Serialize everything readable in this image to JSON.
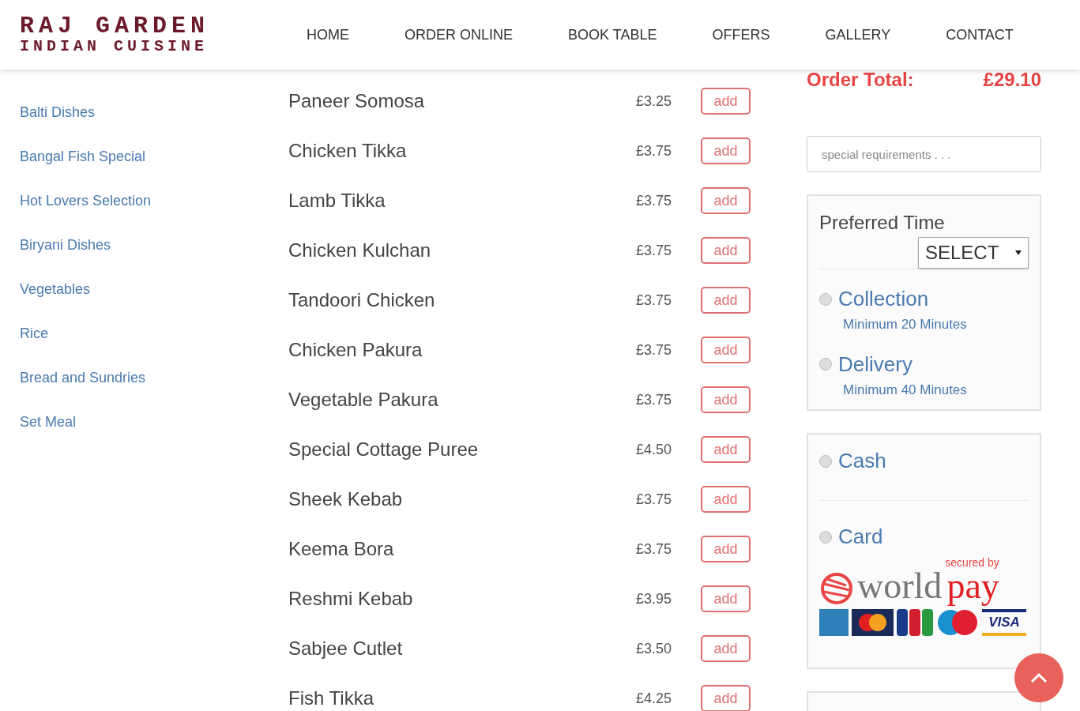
{
  "header": {
    "logo_title": "RAJ GARDEN",
    "logo_subtitle": "INDIAN CUISINE",
    "nav": [
      {
        "label": "HOME"
      },
      {
        "label": "ORDER ONLINE"
      },
      {
        "label": "BOOK TABLE"
      },
      {
        "label": "OFFERS"
      },
      {
        "label": "GALLERY"
      },
      {
        "label": "CONTACT"
      }
    ]
  },
  "categories": [
    "Balti Dishes",
    "Bangal Fish Special",
    "Hot Lovers Selection",
    "Biryani Dishes",
    "Vegetables",
    "Rice",
    "Bread and Sundries",
    "Set Meal"
  ],
  "menu_items": [
    {
      "name": "Paneer Somosa",
      "price": "£3.25",
      "button": "add"
    },
    {
      "name": "Chicken Tikka",
      "price": "£3.75",
      "button": "add"
    },
    {
      "name": "Lamb Tikka",
      "price": "£3.75",
      "button": "add"
    },
    {
      "name": "Chicken Kulchan",
      "price": "£3.75",
      "button": "add"
    },
    {
      "name": "Tandoori Chicken",
      "price": "£3.75",
      "button": "add"
    },
    {
      "name": "Chicken Pakura",
      "price": "£3.75",
      "button": "add"
    },
    {
      "name": "Vegetable Pakura",
      "price": "£3.75",
      "button": "add"
    },
    {
      "name": "Special Cottage Puree",
      "price": "£4.50",
      "button": "add"
    },
    {
      "name": "Sheek Kebab",
      "price": "£3.75",
      "button": "add"
    },
    {
      "name": "Keema Bora",
      "price": "£3.75",
      "button": "add"
    },
    {
      "name": "Reshmi Kebab",
      "price": "£3.95",
      "button": "add"
    },
    {
      "name": "Sabjee Cutlet",
      "price": "£3.50",
      "button": "add"
    },
    {
      "name": "Fish Tikka",
      "price": "£4.25",
      "button": "add"
    }
  ],
  "order": {
    "total_label": "Order Total:",
    "total_value": "£29.10",
    "requirements": {
      "placeholder": "special requirements . . ."
    },
    "preferred_time": {
      "label": "Preferred Time",
      "select": "SELECT"
    },
    "fulfilment": [
      {
        "label": "Collection",
        "note": "Minimum 20 Minutes",
        "selected": false
      },
      {
        "label": "Delivery",
        "note": "Minimum 40 Minutes",
        "selected": false
      }
    ],
    "payment": [
      {
        "label": "Cash",
        "selected": false
      },
      {
        "label": "Card",
        "selected": false
      }
    ],
    "worldpay": {
      "secured": "secured by",
      "world": "world",
      "pay": "pay",
      "visa": "VISA"
    }
  }
}
